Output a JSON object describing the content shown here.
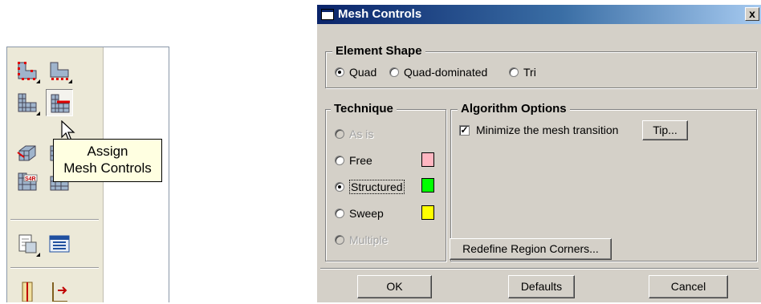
{
  "toolbox": {
    "tooltip": {
      "line1": "Assign",
      "line2": "Mesh Controls"
    },
    "buttons": [
      "seed-part-icon",
      "seed-edge-icon",
      "mesh-element-type-icon",
      "assign-mesh-controls-icon",
      "mesh-region-icon",
      "verify-mesh-icon",
      "element-type-icon",
      "check-mesh-icon",
      "query-icon",
      "mesh-report-icon",
      "partition-icon",
      "delete-mesh-icon"
    ]
  },
  "dialog": {
    "title": "Mesh Controls",
    "close_label": "x",
    "element_shape": {
      "legend": "Element Shape",
      "options": [
        "Quad",
        "Quad-dominated",
        "Tri"
      ],
      "selected": "Quad"
    },
    "technique": {
      "legend": "Technique",
      "options": [
        "As is",
        "Free",
        "Structured",
        "Sweep",
        "Multiple"
      ],
      "selected": "Structured",
      "colors": {
        "free": "#ffb6c1",
        "structured": "#00ff00",
        "sweep": "#ffff00"
      }
    },
    "algorithm": {
      "legend": "Algorithm Options",
      "minimize_label": "Minimize the mesh transition",
      "minimize_checked": "✓",
      "tip_label": "Tip...",
      "redefine_label": "Redefine Region Corners..."
    },
    "buttons": {
      "ok": "OK",
      "defaults": "Defaults",
      "cancel": "Cancel"
    }
  }
}
